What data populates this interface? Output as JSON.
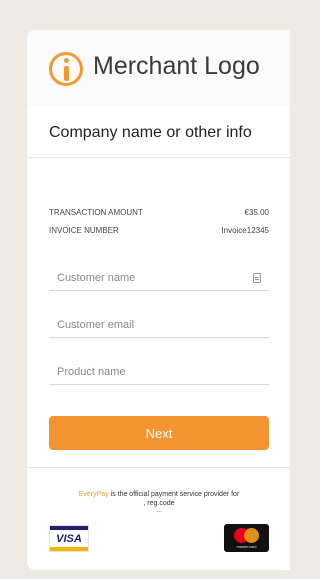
{
  "header": {
    "logo_text": "Merchant Logo",
    "logo_icon": "info-icon",
    "company": "Company name or other info"
  },
  "transaction": {
    "amount_label": "TRANSACTION AMOUNT",
    "amount_value": "€35.00",
    "invoice_label": "INVOICE NUMBER",
    "invoice_value": "Invoice12345"
  },
  "form": {
    "customer_name_placeholder": "Customer name",
    "customer_email_placeholder": "Customer email",
    "product_name_placeholder": "Product name",
    "contact_icon": "contact-card-icon",
    "next_label": "Next"
  },
  "footer": {
    "provider_brand": "EveryPay",
    "provider_text": " is the official payment service provider for",
    "provider_line2": ", reg.code",
    "ellipsis": "...",
    "visa_label": "VISA",
    "mastercard_label": "mastercard"
  },
  "colors": {
    "accent": "#f39431",
    "background": "#efebe4",
    "visa_blue": "#1a1f71",
    "mastercard_red": "#eb001b",
    "mastercard_orange": "#f79e1b"
  }
}
